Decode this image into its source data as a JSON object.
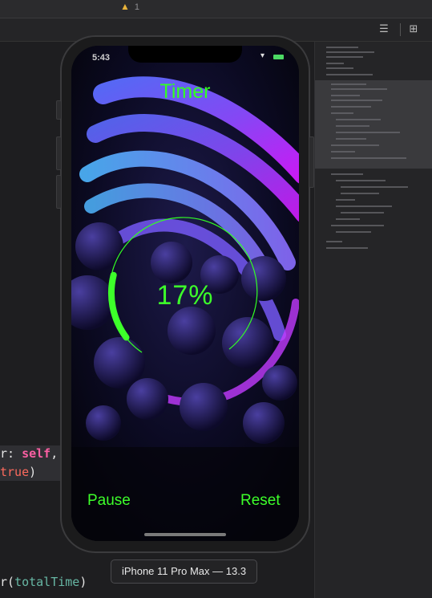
{
  "xcode": {
    "warning_count": "1",
    "code_fragments": {
      "line1_a": "r: ",
      "line1_kw": "self",
      "line1_b": ",",
      "line2_kw": "true",
      "line2_b": ")",
      "line3_a": "r(",
      "line3_fn": "totalTime",
      "line3_b": ")"
    }
  },
  "simulator": {
    "device_label": "iPhone 11 Pro Max — 13.3",
    "status_time": "5:43"
  },
  "app": {
    "title": "Timer",
    "progress_label": "17%",
    "progress_value": 0.17,
    "accent_color": "#32ff24",
    "pause_label": "Pause",
    "reset_label": "Reset"
  }
}
